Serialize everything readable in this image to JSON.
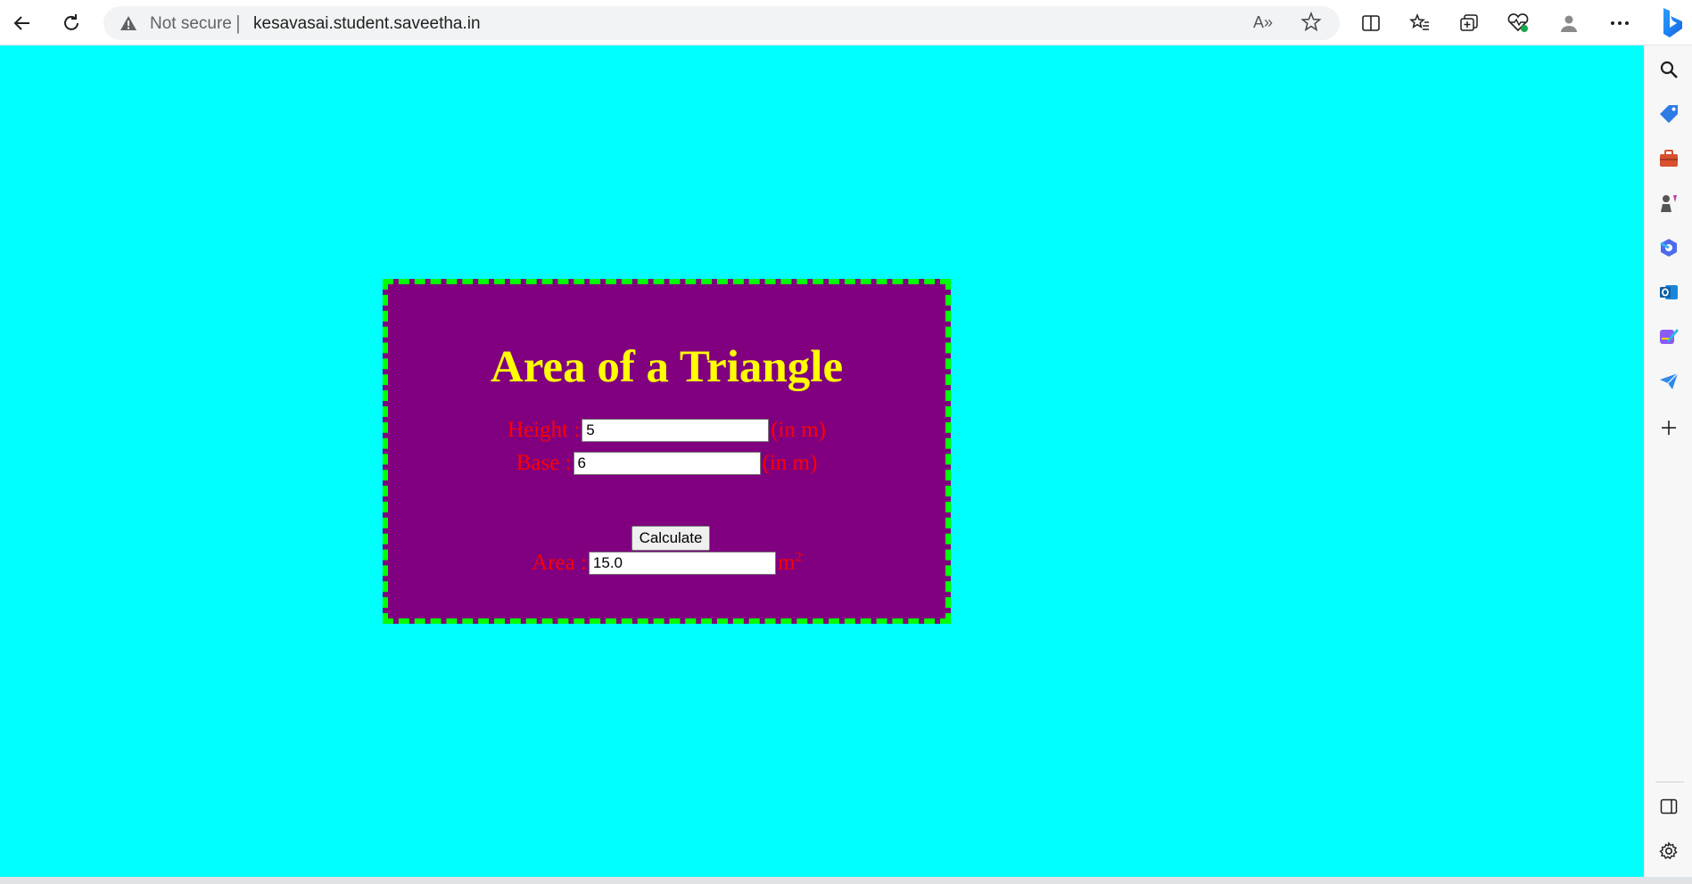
{
  "browser": {
    "security_label": "Not secure",
    "url": "kesavasai.student.saveetha.in",
    "read_aloud_label": "A»",
    "separator": "|"
  },
  "page": {
    "background_color": "#00ffff",
    "card": {
      "background_color": "#800080",
      "border_color": "#00ff00",
      "title": "Area of a Triangle",
      "height_label": "Height :",
      "height_value": "5",
      "height_unit": "(in m)",
      "base_label": "Base :",
      "base_value": "6",
      "base_unit": "(in m)",
      "calculate_label": "Calculate",
      "area_label": "Area :",
      "area_value": "15.0",
      "area_unit": "m",
      "area_unit_exponent": "2"
    }
  },
  "icons": {
    "toolbar": [
      "back-arrow-icon",
      "refresh-icon",
      "warning-icon",
      "read-aloud-icon",
      "favorite-star-icon",
      "split-screen-icon",
      "favorites-icon",
      "collections-icon",
      "performance-icon",
      "profile-icon",
      "more-icon",
      "bing-icon"
    ],
    "sidebar": [
      "search-icon",
      "shopping-icon",
      "tools-icon",
      "games-icon",
      "microsoft365-icon",
      "outlook-icon",
      "designer-icon",
      "send-icon",
      "add-icon",
      "hide-sidebar-icon",
      "settings-icon"
    ]
  }
}
